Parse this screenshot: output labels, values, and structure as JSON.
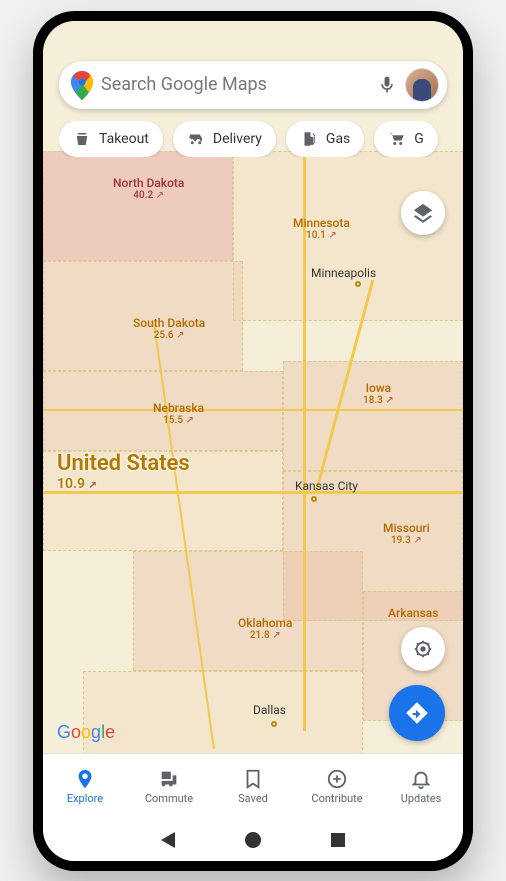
{
  "search": {
    "placeholder": "Search Google Maps"
  },
  "chips": [
    {
      "id": "takeout",
      "label": "Takeout"
    },
    {
      "id": "delivery",
      "label": "Delivery"
    },
    {
      "id": "gas",
      "label": "Gas"
    },
    {
      "id": "groceries",
      "label": "G"
    }
  ],
  "map": {
    "country_label": "United States",
    "country_value": "10.9",
    "states": [
      {
        "id": "nd",
        "name": "North Dakota",
        "value": "40.2",
        "trend": "↗",
        "color": "red"
      },
      {
        "id": "mn",
        "name": "Minnesota",
        "value": "10.1",
        "trend": "↗",
        "color": "brown"
      },
      {
        "id": "sd",
        "name": "South Dakota",
        "value": "25.6",
        "trend": "↗",
        "color": "brown"
      },
      {
        "id": "ia",
        "name": "Iowa",
        "value": "18.3",
        "trend": "↗",
        "color": "brown"
      },
      {
        "id": "ne",
        "name": "Nebraska",
        "value": "15.5",
        "trend": "↗",
        "color": "brown"
      },
      {
        "id": "mo",
        "name": "Missouri",
        "value": "19.3",
        "trend": "↗",
        "color": "brown"
      },
      {
        "id": "ok",
        "name": "Oklahoma",
        "value": "21.8",
        "trend": "↗",
        "color": "brown"
      },
      {
        "id": "ar",
        "name": "Arkansas",
        "value": "",
        "trend": "",
        "color": "brown"
      }
    ],
    "cities": [
      {
        "id": "minneapolis",
        "name": "Minneapolis"
      },
      {
        "id": "kansascity",
        "name": "Kansas City"
      },
      {
        "id": "dallas",
        "name": "Dallas"
      }
    ]
  },
  "logo": "Google",
  "nav": [
    {
      "id": "explore",
      "label": "Explore",
      "active": true
    },
    {
      "id": "commute",
      "label": "Commute",
      "active": false
    },
    {
      "id": "saved",
      "label": "Saved",
      "active": false
    },
    {
      "id": "contribute",
      "label": "Contribute",
      "active": false
    },
    {
      "id": "updates",
      "label": "Updates",
      "active": false
    }
  ]
}
